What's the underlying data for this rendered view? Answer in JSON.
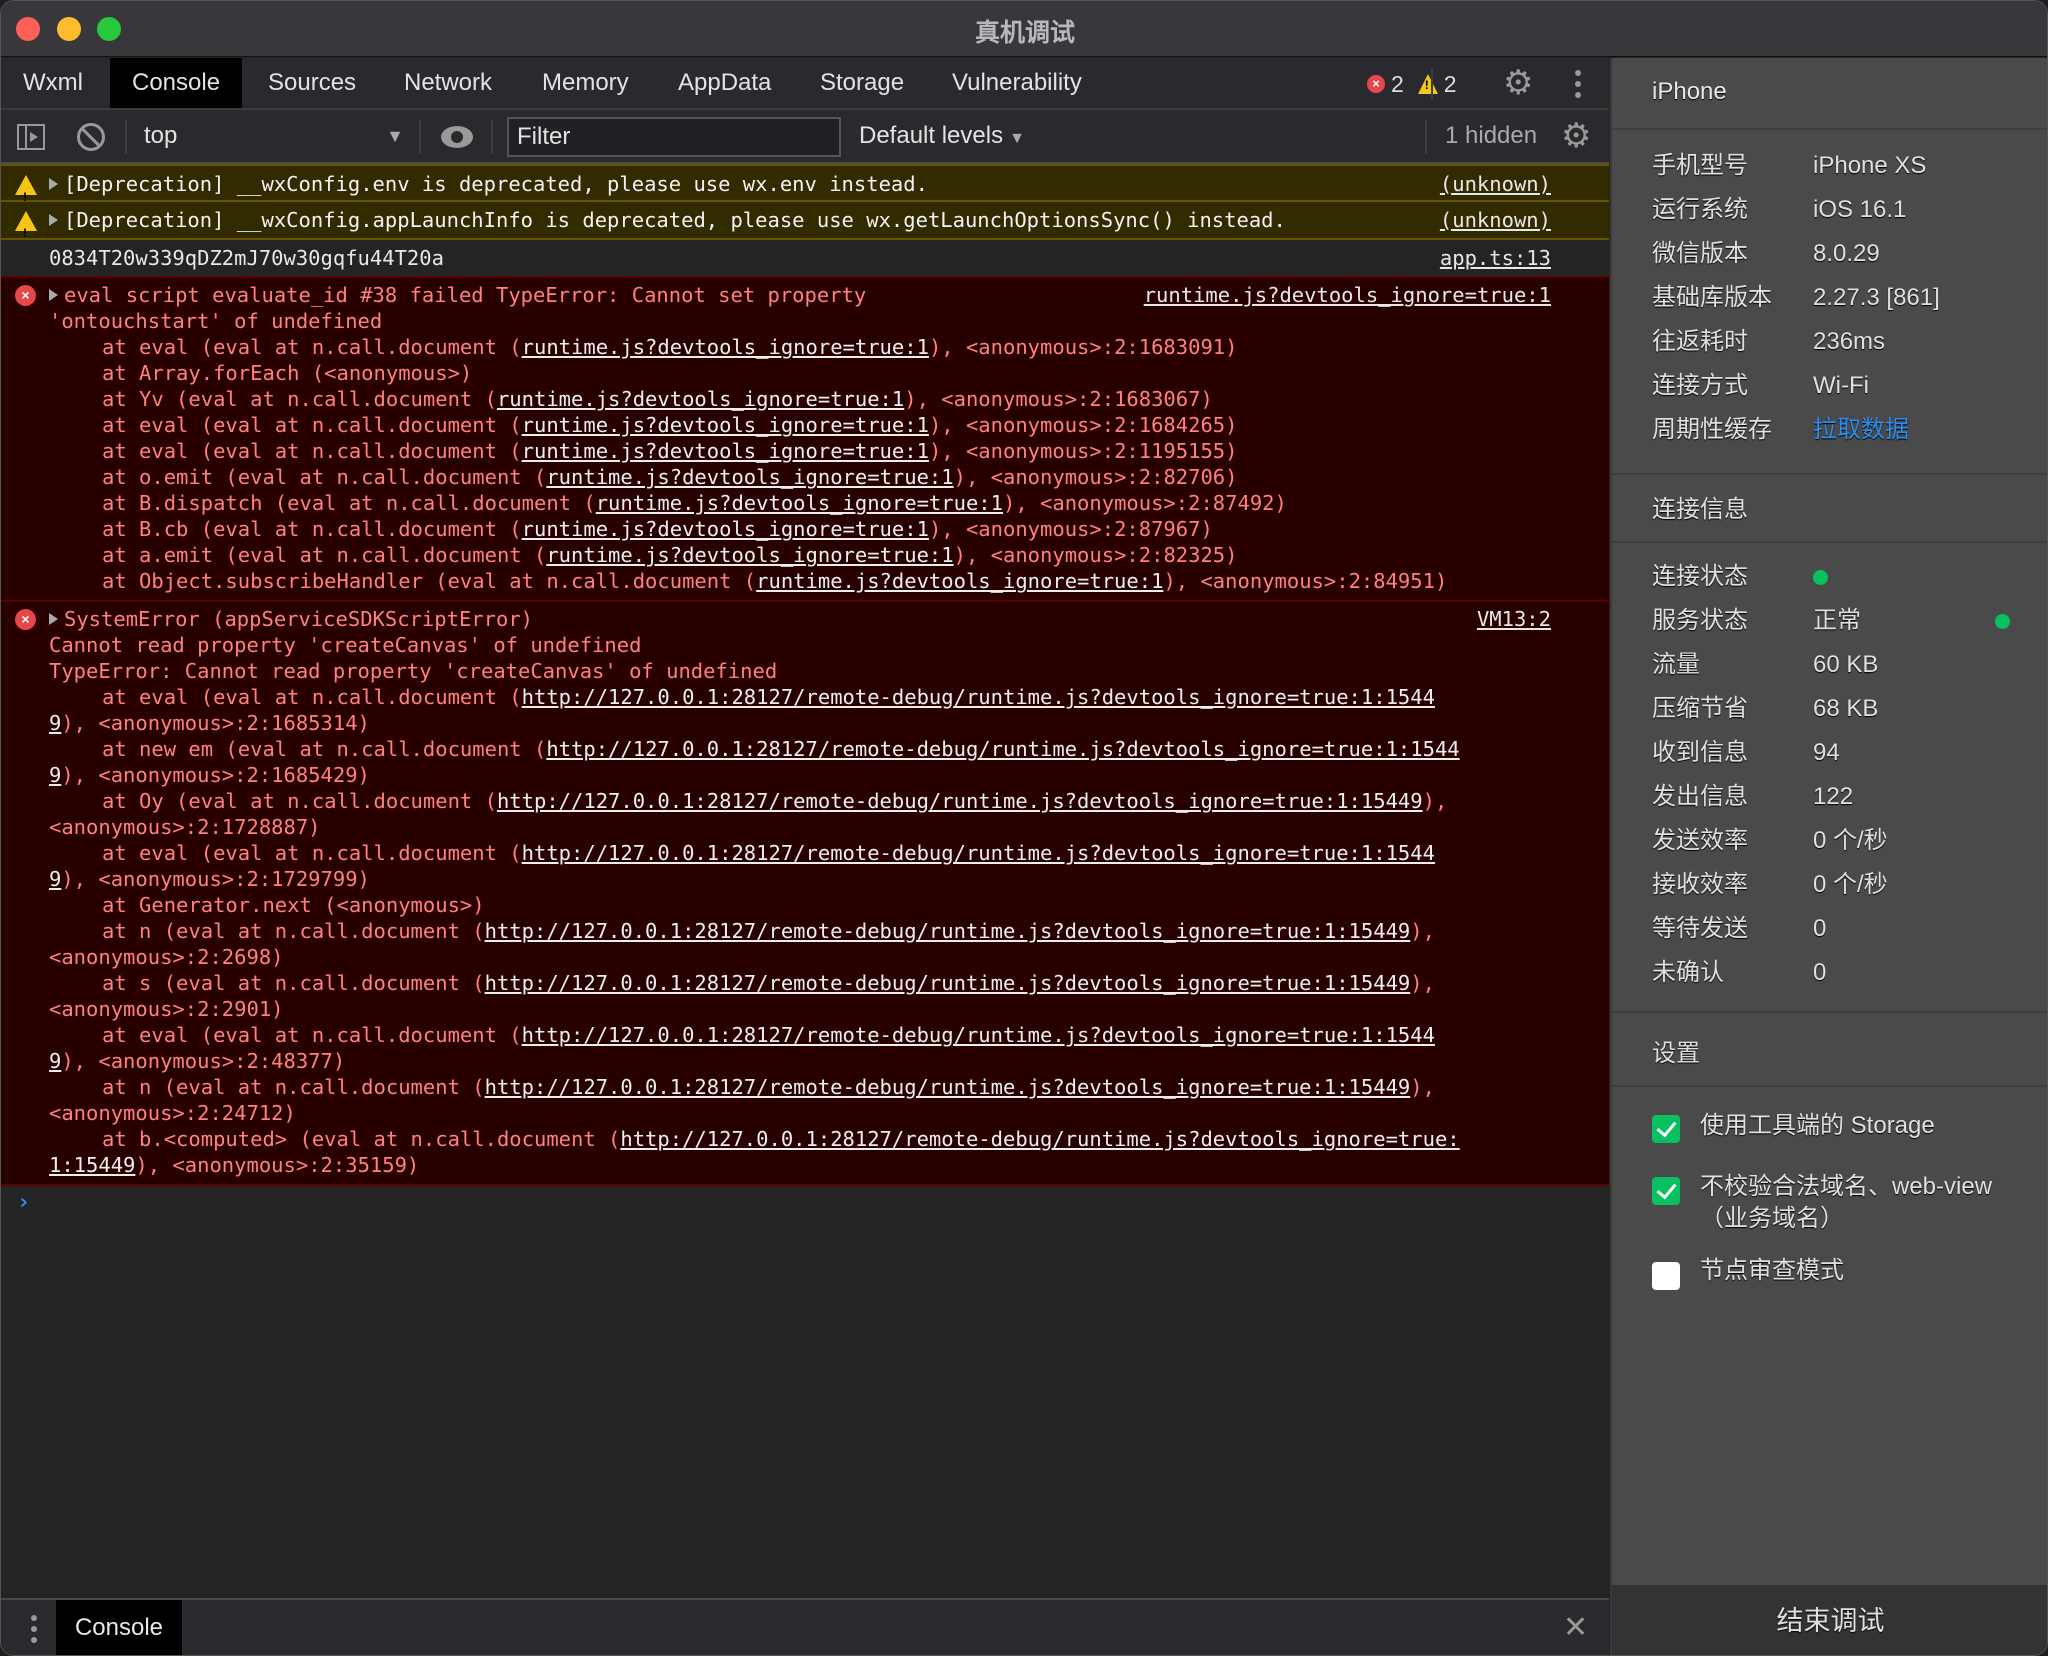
{
  "window": {
    "title": "真机调试"
  },
  "tabs": [
    {
      "label": "Wxml",
      "active": false
    },
    {
      "label": "Console",
      "active": true
    },
    {
      "label": "Sources",
      "active": false
    },
    {
      "label": "Network",
      "active": false
    },
    {
      "label": "Memory",
      "active": false
    },
    {
      "label": "AppData",
      "active": false
    },
    {
      "label": "Storage",
      "active": false
    },
    {
      "label": "Vulnerability",
      "active": false
    }
  ],
  "counts": {
    "errors": "2",
    "warnings": "2"
  },
  "toolbar": {
    "context": "top",
    "filter_placeholder": "Filter",
    "filter_value": "",
    "levels": "Default levels",
    "hidden": "1 hidden"
  },
  "console": {
    "warnings": [
      {
        "text": "[Deprecation] __wxConfig.env is deprecated, please use wx.env instead.",
        "source": "(unknown)"
      },
      {
        "text": "[Deprecation] __wxConfig.appLaunchInfo is deprecated, please use wx.getLaunchOptionsSync() instead.",
        "source": "(unknown)"
      }
    ],
    "log": {
      "text": "0834T20w339qDZ2mJ70w30gqfu44T20a",
      "source": "app.ts:13"
    },
    "error1": {
      "source": "runtime.js?devtools_ignore=true:1",
      "head1": "eval script evaluate_id #38 failed TypeError: Cannot set property",
      "head2": "'ontouchstart' of undefined",
      "stack": [
        {
          "pre": "at eval (eval at n.call.document (",
          "link": "runtime.js?devtools_ignore=true:1",
          "post": "), <anonymous>:2:1683091)"
        },
        {
          "pre": "at Array.forEach (<anonymous>)",
          "link": "",
          "post": ""
        },
        {
          "pre": "at Yv (eval at n.call.document (",
          "link": "runtime.js?devtools_ignore=true:1",
          "post": "), <anonymous>:2:1683067)"
        },
        {
          "pre": "at eval (eval at n.call.document (",
          "link": "runtime.js?devtools_ignore=true:1",
          "post": "), <anonymous>:2:1684265)"
        },
        {
          "pre": "at eval (eval at n.call.document (",
          "link": "runtime.js?devtools_ignore=true:1",
          "post": "), <anonymous>:2:1195155)"
        },
        {
          "pre": "at o.emit (eval at n.call.document (",
          "link": "runtime.js?devtools_ignore=true:1",
          "post": "), <anonymous>:2:82706)"
        },
        {
          "pre": "at B.dispatch (eval at n.call.document (",
          "link": "runtime.js?devtools_ignore=true:1",
          "post": "), <anonymous>:2:87492)"
        },
        {
          "pre": "at B.cb (eval at n.call.document (",
          "link": "runtime.js?devtools_ignore=true:1",
          "post": "), <anonymous>:2:87967)"
        },
        {
          "pre": "at a.emit (eval at n.call.document (",
          "link": "runtime.js?devtools_ignore=true:1",
          "post": "), <anonymous>:2:82325)"
        },
        {
          "pre": "at Object.subscribeHandler (eval at n.call.document (",
          "link": "runtime.js?devtools_ignore=true:1",
          "post": "), <anonymous>:2:84951)"
        }
      ]
    },
    "error2": {
      "source": "VM13:2",
      "head1": "SystemError (appServiceSDKScriptError)",
      "lines": [
        {
          "type": "plain",
          "text": "Cannot read property 'createCanvas' of undefined"
        },
        {
          "type": "plain",
          "text": "TypeError: Cannot read property 'createCanvas' of undefined"
        },
        {
          "type": "stack",
          "pre": "at eval (eval at n.call.document (",
          "link": "http://127.0.0.1:28127/remote-debug/runtime.js?devtools_ignore=true:1:1544",
          "post": ""
        },
        {
          "type": "cont",
          "link": "9",
          "post": "), <anonymous>:2:1685314)"
        },
        {
          "type": "stack",
          "pre": "at new em (eval at n.call.document (",
          "link": "http://127.0.0.1:28127/remote-debug/runtime.js?devtools_ignore=true:1:1544",
          "post": ""
        },
        {
          "type": "cont",
          "link": "9",
          "post": "), <anonymous>:2:1685429)"
        },
        {
          "type": "stack",
          "pre": "at Oy (eval at n.call.document (",
          "link": "http://127.0.0.1:28127/remote-debug/runtime.js?devtools_ignore=true:1:15449",
          "post": "),"
        },
        {
          "type": "cont",
          "link": "",
          "post": "<anonymous>:2:1728887)"
        },
        {
          "type": "stack",
          "pre": "at eval (eval at n.call.document (",
          "link": "http://127.0.0.1:28127/remote-debug/runtime.js?devtools_ignore=true:1:1544",
          "post": ""
        },
        {
          "type": "cont",
          "link": "9",
          "post": "), <anonymous>:2:1729799)"
        },
        {
          "type": "stack",
          "pre": "at Generator.next (<anonymous>)",
          "link": "",
          "post": ""
        },
        {
          "type": "stack",
          "pre": "at n (eval at n.call.document (",
          "link": "http://127.0.0.1:28127/remote-debug/runtime.js?devtools_ignore=true:1:15449",
          "post": "),"
        },
        {
          "type": "cont",
          "link": "",
          "post": "<anonymous>:2:2698)"
        },
        {
          "type": "stack",
          "pre": "at s (eval at n.call.document (",
          "link": "http://127.0.0.1:28127/remote-debug/runtime.js?devtools_ignore=true:1:15449",
          "post": "),"
        },
        {
          "type": "cont",
          "link": "",
          "post": "<anonymous>:2:2901)"
        },
        {
          "type": "stack",
          "pre": "at eval (eval at n.call.document (",
          "link": "http://127.0.0.1:28127/remote-debug/runtime.js?devtools_ignore=true:1:1544",
          "post": ""
        },
        {
          "type": "cont",
          "link": "9",
          "post": "), <anonymous>:2:48377)"
        },
        {
          "type": "stack",
          "pre": "at n (eval at n.call.document (",
          "link": "http://127.0.0.1:28127/remote-debug/runtime.js?devtools_ignore=true:1:15449",
          "post": "),"
        },
        {
          "type": "cont",
          "link": "",
          "post": "<anonymous>:2:24712)"
        },
        {
          "type": "stack",
          "pre": "at b.<computed> (eval at n.call.document (",
          "link": "http://127.0.0.1:28127/remote-debug/runtime.js?devtools_ignore=true:",
          "post": ""
        },
        {
          "type": "cont",
          "link": "1:15449",
          "post": "), <anonymous>:2:35159)"
        }
      ]
    },
    "prompt": "›"
  },
  "drawer": {
    "tab": "Console",
    "close": "✕"
  },
  "panel": {
    "device": "iPhone",
    "info": [
      {
        "key": "手机型号",
        "value": "iPhone XS"
      },
      {
        "key": "运行系统",
        "value": "iOS 16.1"
      },
      {
        "key": "微信版本",
        "value": "8.0.29"
      },
      {
        "key": "基础库版本",
        "value": "2.27.3 [861]"
      },
      {
        "key": "往返耗时",
        "value": "236ms"
      },
      {
        "key": "连接方式",
        "value": "Wi-Fi"
      },
      {
        "key": "周期性缓存",
        "value": "拉取数据",
        "link": true
      }
    ],
    "connection_title": "连接信息",
    "connection": [
      {
        "key": "连接状态",
        "value": "",
        "status": "connected"
      },
      {
        "key": "服务状态",
        "value": "正常",
        "status": "ok"
      },
      {
        "key": "流量",
        "value": "60 KB"
      },
      {
        "key": "压缩节省",
        "value": "68 KB"
      },
      {
        "key": "收到信息",
        "value": "94"
      },
      {
        "key": "发出信息",
        "value": "122"
      },
      {
        "key": "发送效率",
        "value": "0 个/秒"
      },
      {
        "key": "接收效率",
        "value": "0 个/秒"
      },
      {
        "key": "等待发送",
        "value": "0"
      },
      {
        "key": "未确认",
        "value": "0"
      }
    ],
    "settings_title": "设置",
    "settings": [
      {
        "label": "使用工具端的 Storage",
        "checked": true
      },
      {
        "label": "不校验合法域名、web-view（业务域名）",
        "checked": true
      },
      {
        "label": "节点审查模式",
        "checked": false
      }
    ],
    "end_button": "结束调试"
  },
  "colors": {
    "accent_green": "#07c160",
    "link_blue": "#2d8cf0",
    "error_text": "#ff8080",
    "error_bg": "#290000",
    "warning_bg": "#332b00"
  }
}
